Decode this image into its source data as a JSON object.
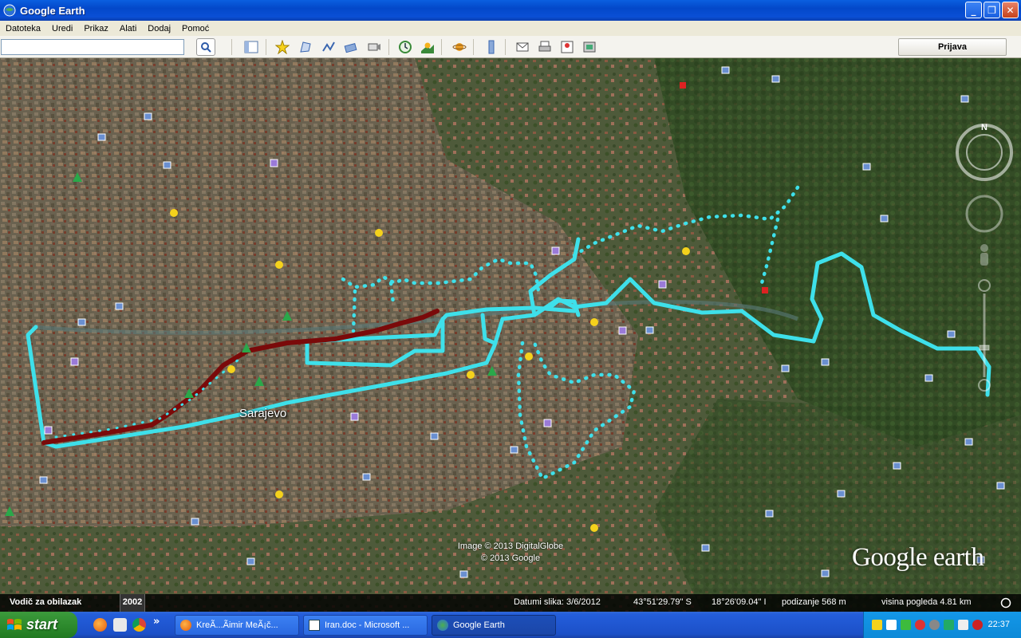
{
  "window": {
    "title": "Google Earth",
    "minimize_label": "_",
    "maximize_label": "❐",
    "close_label": "✕"
  },
  "menu": [
    "Datoteka",
    "Uredi",
    "Prikaz",
    "Alati",
    "Dodaj",
    "Pomoć"
  ],
  "toolbar": {
    "search_value": "",
    "login_label": "Prijava",
    "buttons": [
      "search-icon",
      "sidebar-icon",
      "placemark-icon",
      "polygon-icon",
      "path-icon",
      "overlay-icon",
      "tour-icon",
      "history-icon",
      "sun-icon",
      "planets-icon",
      "ruler-icon",
      "email-icon",
      "print-icon",
      "maps-icon",
      "save-image-icon"
    ]
  },
  "map": {
    "city_label": "Sarajevo",
    "attribution_line1": "Image © 2013 DigitalGlobe",
    "attribution_line2": "© 2013 Google",
    "logo_text": "Google earth",
    "compass_letter": "N",
    "track_colors": {
      "cyan": "#3ee0ea",
      "maroon": "#7a0a0a"
    }
  },
  "statusbar": {
    "tour_guide": "Vodič za obilazak",
    "year": "2002",
    "image_date": "Datumi slika: 3/6/2012",
    "lat": "43°51'29.79\" S",
    "lon": "18°26'09.04\" I",
    "elev": "podizanje   568 m",
    "eye_alt": "visina pogleda   4.81 km"
  },
  "taskbar": {
    "start_label": "start",
    "tasks": [
      "KreÃ...Ãimir MeÃ¡č...",
      "Iran.doc - Microsoft ...",
      "Google Earth"
    ],
    "clock": "22:37",
    "chevron": "»"
  }
}
